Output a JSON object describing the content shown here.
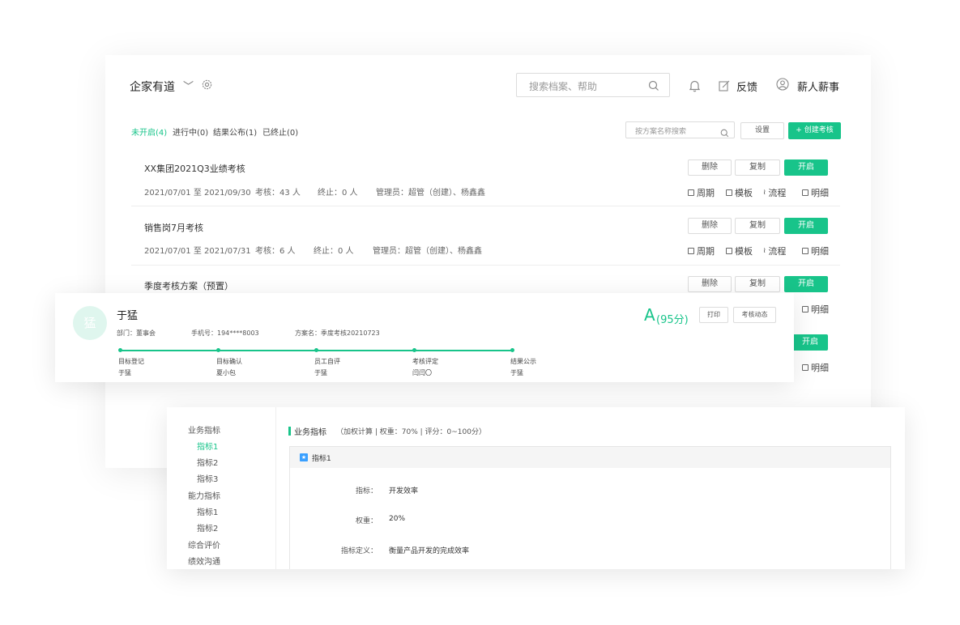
{
  "header": {
    "company": "企家有道",
    "search_placeholder": "搜索档案、帮助",
    "feedback": "反馈",
    "user": "薪人薪事"
  },
  "tabs": [
    {
      "label": "未开启(4)",
      "active": true
    },
    {
      "label": "进行中(0)",
      "active": false
    },
    {
      "label": "结果公布(1)",
      "active": false
    },
    {
      "label": "已终止(0)",
      "active": false
    }
  ],
  "toolbar": {
    "search_placeholder": "按方案名称搜索",
    "settings_label": "设置",
    "create_label": "+ 创建考核"
  },
  "rows": [
    {
      "title": "XX集团2021Q3业绩考核",
      "date_range": "2021/07/01 至 2021/09/30",
      "assess": "考核：43 人",
      "terminated": "终止：0 人",
      "managers": "管理员：超管（创建）、杨鑫鑫",
      "delete": "删除",
      "copy": "复制",
      "open": "开启",
      "actions": [
        "周期",
        "模板",
        "流程",
        "明细"
      ]
    },
    {
      "title": "销售岗7月考核",
      "date_range": "2021/07/01 至 2021/07/31",
      "assess": "考核：6 人",
      "terminated": "终止：0 人",
      "managers": "管理员：超管（创建）、杨鑫鑫",
      "delete": "删除",
      "copy": "复制",
      "open": "开启",
      "actions": [
        "周期",
        "模板",
        "流程",
        "明细"
      ]
    },
    {
      "title": "季度考核方案（预置）",
      "delete": "删除",
      "copy": "复制",
      "open": "开启",
      "detail": "明细"
    },
    {
      "open": "开启",
      "detail": "明细"
    }
  ],
  "person": {
    "avatar_text": "猛",
    "name": "于猛",
    "department": "部门：董事会",
    "phone": "手机号：194****8003",
    "plan": "方案名：季度考核20210723",
    "grade": "A",
    "score": "(95分)",
    "print": "打印",
    "dynamics": "考核动态",
    "steps": [
      {
        "label": "目标登记",
        "sub": "于猛"
      },
      {
        "label": "目标确认",
        "sub": "夏小包"
      },
      {
        "label": "员工自评",
        "sub": "于猛"
      },
      {
        "label": "考核评定",
        "sub": "闫闫〇"
      },
      {
        "label": "结果公示",
        "sub": "于猛"
      }
    ]
  },
  "detail": {
    "sidebar": [
      {
        "label": "业务指标",
        "level": 0,
        "active": false
      },
      {
        "label": "指标1",
        "level": 1,
        "active": true
      },
      {
        "label": "指标2",
        "level": 1,
        "active": false
      },
      {
        "label": "指标3",
        "level": 1,
        "active": false
      },
      {
        "label": "能力指标",
        "level": 0,
        "active": false
      },
      {
        "label": "指标1",
        "level": 1,
        "active": false
      },
      {
        "label": "指标2",
        "level": 1,
        "active": false
      },
      {
        "label": "综合评价",
        "level": 0,
        "active": false
      },
      {
        "label": "绩效沟通",
        "level": 0,
        "active": false
      }
    ],
    "section_title": "业务指标",
    "section_meta": "（加权计算 | 权重：70% | 评分：0~100分）",
    "box_title": "指标1",
    "fields": [
      {
        "label": "指标：",
        "value": "开发效率"
      },
      {
        "label": "权重：",
        "value": "20%"
      },
      {
        "label": "指标定义：",
        "value": "衡量产品开发的完成效率"
      }
    ]
  },
  "colors": {
    "accent": "#18c48a",
    "avatar_bg": "#dff6ee"
  }
}
